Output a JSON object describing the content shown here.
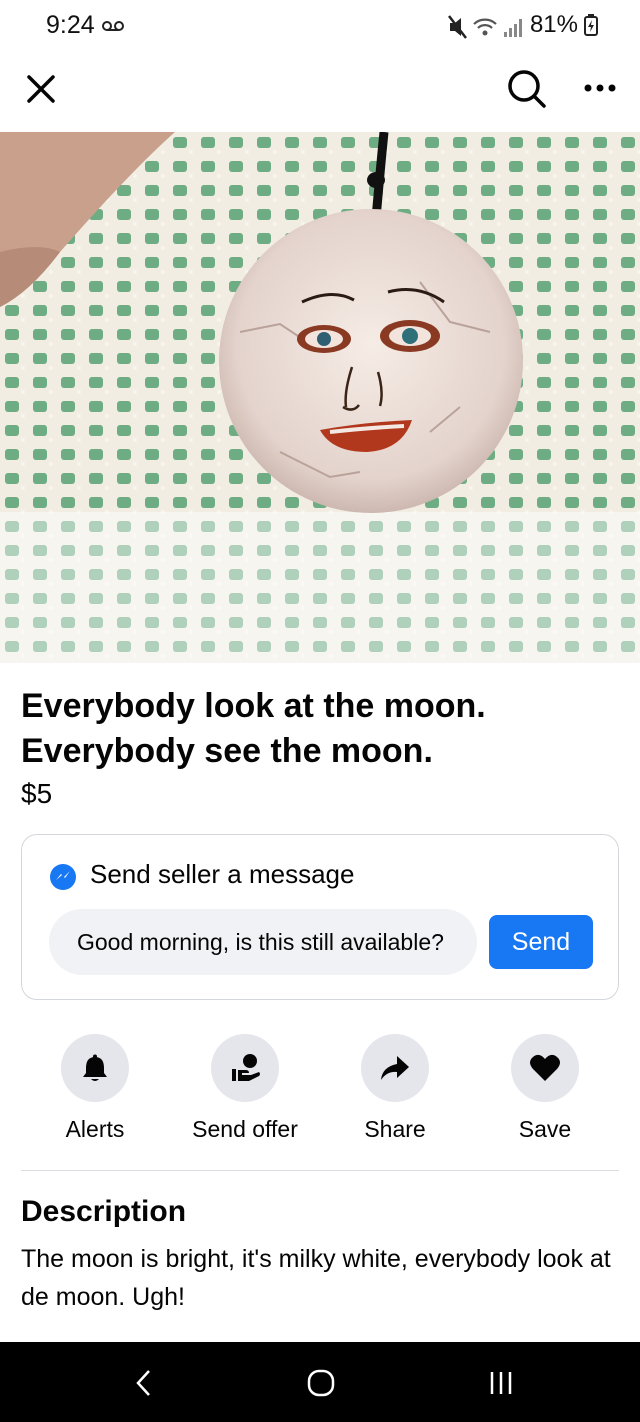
{
  "status_bar": {
    "time": "9:24",
    "battery": "81%",
    "icons": [
      "voicemail-icon",
      "mute-icon",
      "wifi-icon",
      "signal-icon",
      "battery-icon"
    ]
  },
  "top_nav": {
    "icons": [
      "close-icon",
      "search-icon",
      "more-icon"
    ]
  },
  "listing": {
    "photo_icon": "moon-ornament-photo",
    "title": "Everybody look at the moon. Everybody see the moon.",
    "price": "$5"
  },
  "message": {
    "heading": "Send seller a message",
    "input_value": "Good morning, is this still available?",
    "send_label": "Send",
    "accent_color": "#1877f2"
  },
  "actions": [
    {
      "label": "Alerts",
      "icon": "bell-icon"
    },
    {
      "label": "Send offer",
      "icon": "send-offer-icon"
    },
    {
      "label": "Share",
      "icon": "share-icon"
    },
    {
      "label": "Save",
      "icon": "heart-icon"
    }
  ],
  "description": {
    "heading": "Description",
    "text": "The moon is bright, it's milky white, everybody look at de moon. Ugh!"
  },
  "nav_bar": {
    "icons": [
      "back-icon",
      "home-icon",
      "recents-icon"
    ]
  }
}
